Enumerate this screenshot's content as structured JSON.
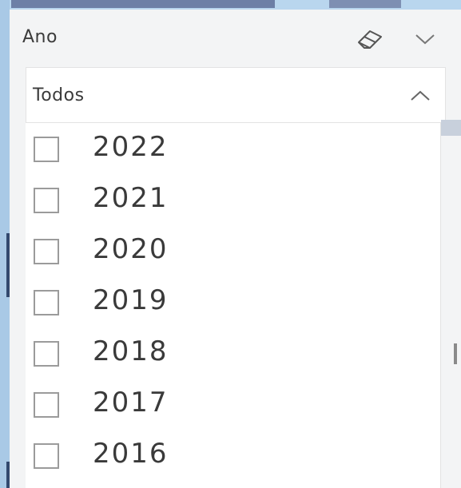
{
  "slicer": {
    "title": "Ano",
    "clear_icon": "eraser-icon",
    "collapse_icon": "chevron-down-icon",
    "dropdown": {
      "selected": "Todos",
      "toggle_icon": "chevron-up-icon"
    },
    "items": [
      {
        "label": "2022",
        "checked": false
      },
      {
        "label": "2021",
        "checked": false
      },
      {
        "label": "2020",
        "checked": false
      },
      {
        "label": "2019",
        "checked": false
      },
      {
        "label": "2018",
        "checked": false
      },
      {
        "label": "2017",
        "checked": false
      },
      {
        "label": "2016",
        "checked": false
      }
    ]
  },
  "colors": {
    "background": "#b9d6ee",
    "panel": "#f3f4f5",
    "text": "#3b3b3b",
    "checkbox_border": "#9b9b9b"
  }
}
